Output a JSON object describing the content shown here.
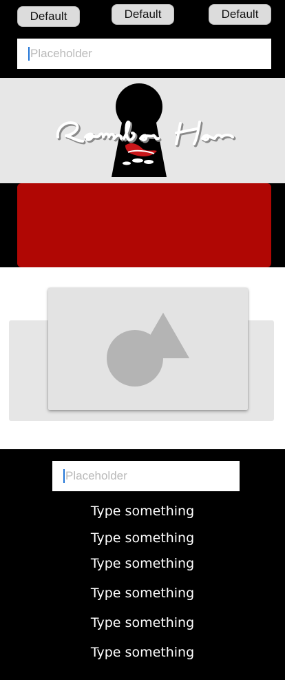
{
  "top_buttons": [
    "Default",
    "Default",
    "Default"
  ],
  "top_input": {
    "placeholder": "Placeholder"
  },
  "banner": {
    "title_art": "Remember Her"
  },
  "bottom_input": {
    "placeholder": "Placeholder"
  },
  "text_lines": [
    "Type something",
    "Type something",
    "Type something",
    "Type something",
    "Type something",
    "Type something"
  ],
  "colors": {
    "background": "#000000",
    "banner": "#e7e7e7",
    "red_block": "#b00704",
    "caret": "#1e73d6",
    "card": "#e3e3e3"
  },
  "icons": {
    "image_placeholder": "image-placeholder-icon",
    "keyhole": "keyhole-icon"
  }
}
